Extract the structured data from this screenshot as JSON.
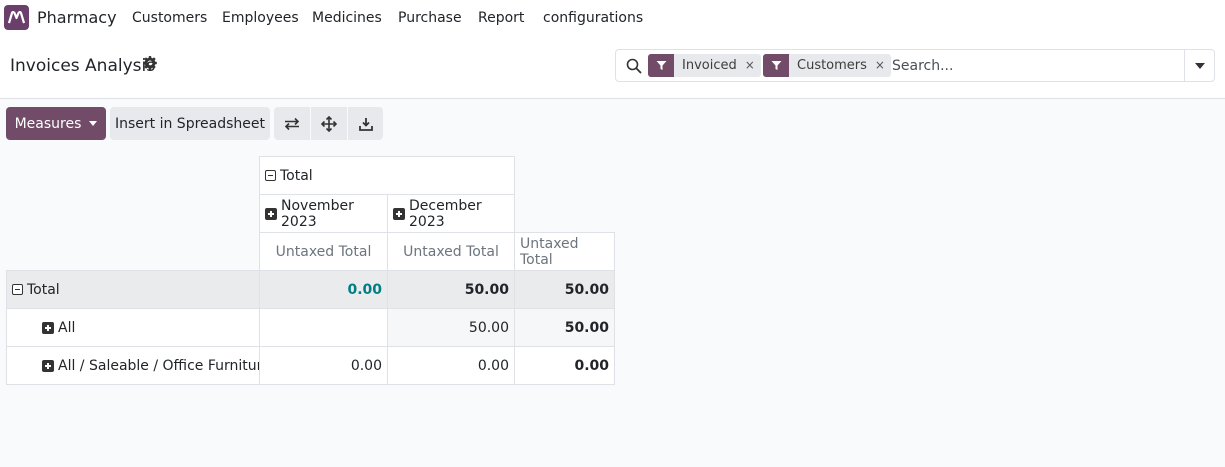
{
  "navbar": {
    "brand": "Pharmacy",
    "items": [
      "Customers",
      "Employees",
      "Medicines",
      "Purchase",
      "Report",
      "configurations"
    ]
  },
  "control": {
    "title": "Invoices Analysis",
    "search": {
      "facets": [
        "Invoiced",
        "Customers"
      ],
      "placeholder": "Search..."
    }
  },
  "toolbar": {
    "measures_label": "Measures",
    "insert_label": "Insert in Spreadsheet"
  },
  "pivot": {
    "col_root": "Total",
    "col_groups": [
      "November 2023",
      "December 2023"
    ],
    "measure": "Untaxed Total",
    "rows": [
      {
        "label": "Total",
        "values": [
          "0.00",
          "50.00",
          "50.00"
        ]
      },
      {
        "label": "All",
        "values": [
          "",
          "50.00",
          "50.00"
        ]
      },
      {
        "label": "All / Saleable / Office Furniture",
        "values": [
          "0.00",
          "0.00",
          "0.00"
        ]
      }
    ]
  },
  "colors": {
    "brand": "#714b67",
    "teal": "#017e84"
  }
}
